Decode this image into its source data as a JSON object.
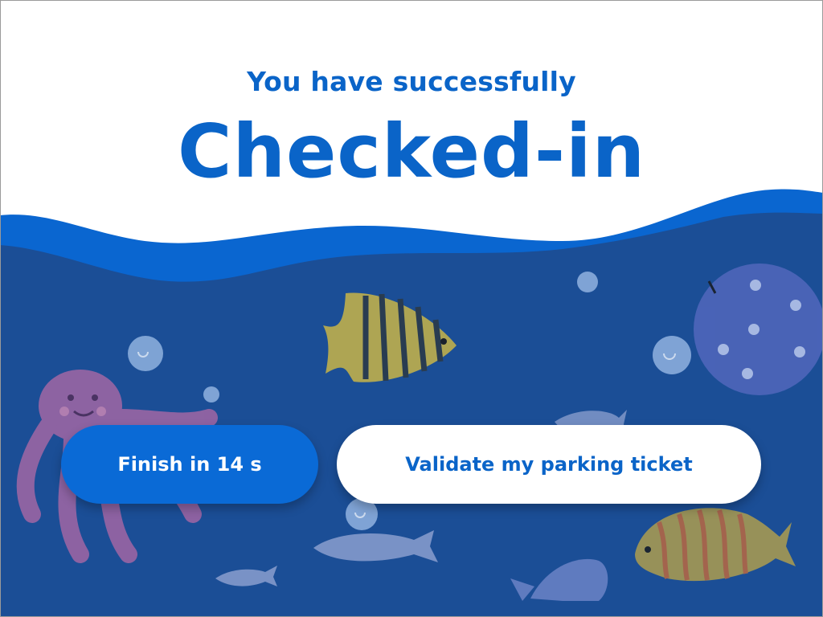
{
  "screen": {
    "subtitle": "You have successfully",
    "title": "Checked-in"
  },
  "actions": {
    "finish_label": "Finish in 14 s",
    "validate_label": "Validate my parking ticket"
  },
  "colors": {
    "primary_blue": "#0a6ad6",
    "title_blue": "#0a64c8",
    "sea_deep": "#1b4e96",
    "wave_band": "#0a66d0",
    "background": "#ffffff"
  },
  "decorations": [
    "octopus-illustration",
    "striped-fish-illustration",
    "pufferfish-illustration",
    "orange-striped-fish-illustration",
    "grey-fish-illustration",
    "bubble-icons"
  ]
}
